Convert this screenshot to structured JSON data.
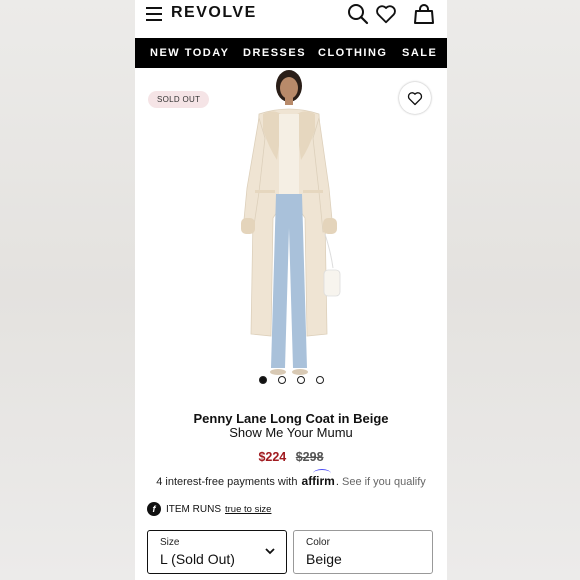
{
  "brand": {
    "logo": "REVOLVE"
  },
  "nav": {
    "items": [
      "NEW TODAY",
      "DRESSES",
      "CLOTHING",
      "SALE"
    ]
  },
  "product": {
    "badge": "SOLD OUT",
    "title": "Penny Lane Long Coat in Beige",
    "brand_name": "Show Me Your Mumu",
    "sale_price": "$224",
    "original_price": "$298",
    "gallery_count": 4,
    "gallery_active_index": 0
  },
  "financing": {
    "text": "4 interest-free payments with",
    "provider": "affirm",
    "link": "See if you qualify"
  },
  "fit": {
    "label": "ITEM RUNS",
    "value": "true to size"
  },
  "size_select": {
    "label": "Size",
    "value": "L (Sold Out)"
  },
  "color_select": {
    "label": "Color",
    "value": "Beige"
  },
  "colors": {
    "nav_bg": "#000000",
    "sale_price": "#a01b20",
    "badge_bg": "#f5e4e6",
    "coat": "#efe4d3",
    "jeans": "#a9c1da"
  },
  "icons": [
    "menu-icon",
    "search-icon",
    "heart-icon",
    "bag-icon",
    "wishlist-heart-icon",
    "fit-icon",
    "chevron-down-icon"
  ]
}
